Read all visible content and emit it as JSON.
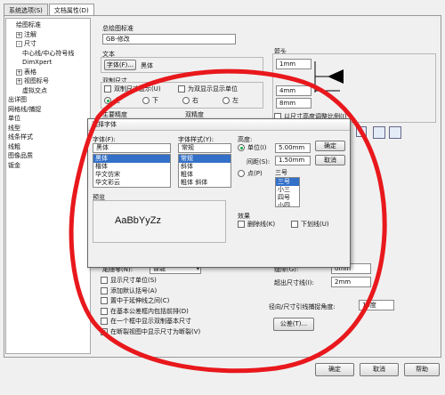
{
  "tabs": [
    "系统选项(S)",
    "文档属性(D)"
  ],
  "tree": [
    {
      "label": "绘图标准",
      "level": 1,
      "pm": ""
    },
    {
      "label": "注解",
      "level": 1,
      "pm": "+"
    },
    {
      "label": "尺寸",
      "level": 1,
      "pm": "-"
    },
    {
      "label": "中心线/中心符号线",
      "level": 3,
      "pm": ""
    },
    {
      "label": "DimXpert",
      "level": 3,
      "pm": ""
    },
    {
      "label": "表格",
      "level": 1,
      "pm": "+"
    },
    {
      "label": "视图标号",
      "level": 1,
      "pm": "+"
    },
    {
      "label": "虚拟交点",
      "level": 3,
      "pm": ""
    },
    {
      "label": "出详图",
      "level": 0,
      "pm": ""
    },
    {
      "label": "网格线/捕捉",
      "level": 0,
      "pm": ""
    },
    {
      "label": "单位",
      "level": 0,
      "pm": ""
    },
    {
      "label": "线型",
      "level": 0,
      "pm": ""
    },
    {
      "label": "线条样式",
      "level": 0,
      "pm": ""
    },
    {
      "label": "线粗",
      "level": 0,
      "pm": ""
    },
    {
      "label": "图像品质",
      "level": 0,
      "pm": ""
    },
    {
      "label": "钣金",
      "level": 0,
      "pm": ""
    }
  ],
  "main": {
    "std_label": "总绘图标准",
    "std_value": "GB-修改",
    "text_label": "文本",
    "font_button": "字体(F)...",
    "font_value": "黑体",
    "dual_label": "双制尺寸",
    "dual_check": "双制尺寸显示(U)",
    "top_check": "为双显示显示单位",
    "radios": [
      "上",
      "下",
      "右",
      "左"
    ],
    "precision_label": "主要精度",
    "dual_precision_label": "双精度",
    "arrow_label": "箭头",
    "arrow_values": [
      "1mm",
      "4mm",
      "8mm"
    ],
    "scale_check": "以尺寸高度调整比例(I)",
    "dim_placement_label": "尾随零(N):",
    "dim_placement_value": "智能",
    "checks": [
      {
        "label": "显示尺寸单位(S)",
        "checked": false
      },
      {
        "label": "添加默认括号(A)",
        "checked": false
      },
      {
        "label": "置中于延伸线之间(C)",
        "checked": false
      },
      {
        "label": "在基本公差框内包括前排(D)",
        "checked": false
      },
      {
        "label": "在一个框中显示双制基本尺寸",
        "checked": false
      },
      {
        "label": "在断裂视图中显示尺寸为断裂(V)",
        "checked": true
      }
    ],
    "gap_label": "缝隙(G):",
    "gap_value": "0mm",
    "extend_label": "超出尺寸线(I):",
    "extend_value": "2mm",
    "angle_label": "径向/尺寸引线捕捉角度:",
    "angle_value": "15度",
    "tol_button": "公差(T)..."
  },
  "dialog": {
    "title": "选择字体",
    "font_label": "字体(F):",
    "font_value": "黑体",
    "fonts": [
      "黑体",
      "楷体",
      "华文仿宋",
      "华文彩云"
    ],
    "style_label": "字体样式(Y):",
    "style_value": "常规",
    "styles": [
      "常规",
      "斜体",
      "粗体",
      "粗体 斜体"
    ],
    "height_label": "高度:",
    "unit_radio": "单位(I)",
    "unit_value": "5.00mm",
    "spacing_label": "间距(S):",
    "spacing_value": "1.50mm",
    "point_radio": "点(P)",
    "size_value": "三号",
    "sizes": [
      "三号",
      "小三",
      "四号",
      "小四"
    ],
    "ok": "确定",
    "cancel": "取消",
    "preview_label": "预览",
    "preview_text": "AaBbYyZz",
    "effects_label": "效果",
    "strike": "删除线(K)",
    "underline": "下划线(U)"
  },
  "bottom": {
    "ok": "确定",
    "cancel": "取消",
    "help": "帮助"
  },
  "colors": {
    "annotation": "#e8181c",
    "selection": "#3370c8"
  }
}
